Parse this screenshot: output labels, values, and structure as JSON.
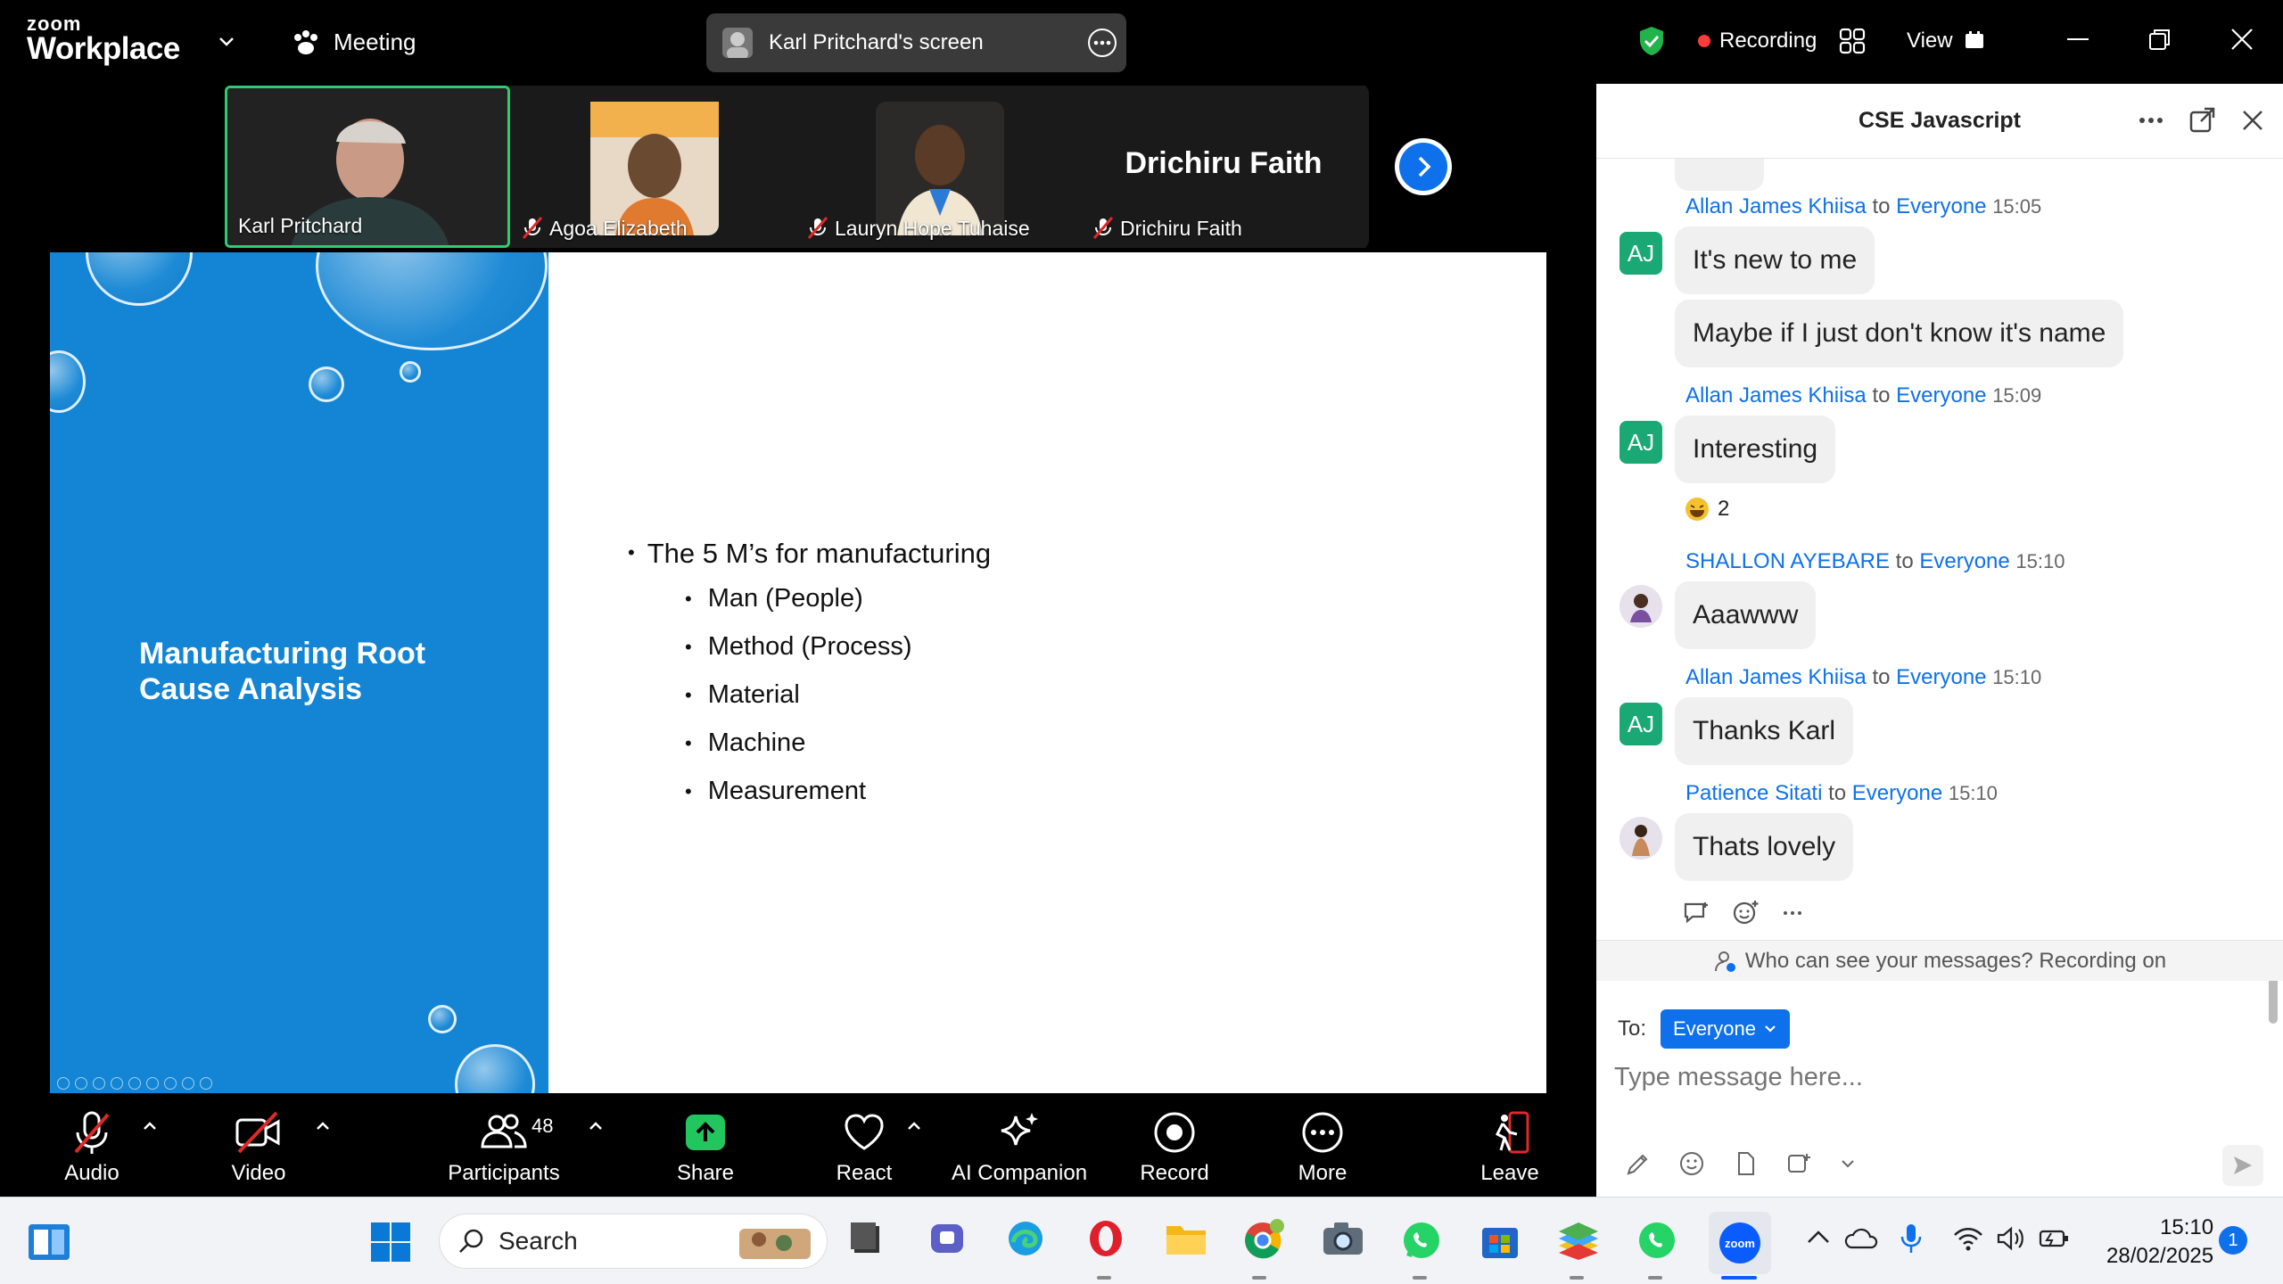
{
  "topbar": {
    "logo_small": "zoom",
    "logo_big": "Workplace",
    "meeting_label": "Meeting",
    "screen_share_label": "Karl Pritchard's screen",
    "recording_label": "Recording",
    "view_label": "View"
  },
  "participants_strip": [
    {
      "name": "Karl Pritchard",
      "muted": false,
      "active_speaker": true
    },
    {
      "name": "Agoa Elizabeth",
      "muted": true
    },
    {
      "name": "Lauryn Hope Tuhaise",
      "muted": true
    },
    {
      "name": "Drichiru Faith",
      "muted": true,
      "big_name": "Drichiru Faith"
    }
  ],
  "slide": {
    "title": "Manufacturing Root\nCause Analysis",
    "main_bullet": "The 5 M’s for manufacturing",
    "sub_bullets": [
      "Man (People)",
      "Method (Process)",
      "Material",
      "Machine",
      "Measurement"
    ]
  },
  "toolbar": {
    "audio": "Audio",
    "video": "Video",
    "participants": "Participants",
    "participants_count": "48",
    "share": "Share",
    "react": "React",
    "ai_companion": "AI Companion",
    "record": "Record",
    "more": "More",
    "leave": "Leave"
  },
  "chat": {
    "title": "CSE Javascript",
    "to_word": "to",
    "messages": [
      {
        "sender": "Allan James Khiisa",
        "recipient": "Everyone",
        "time": "15:05",
        "avatar": "AJ",
        "texts": [
          "It's new to me",
          "Maybe if I just don't know it's name"
        ]
      },
      {
        "sender": "Allan James Khiisa",
        "recipient": "Everyone",
        "time": "15:09",
        "avatar": "AJ",
        "texts": [
          "Interesting"
        ],
        "reaction_count": "2"
      },
      {
        "sender": "SHALLON AYEBARE",
        "recipient": "Everyone",
        "time": "15:10",
        "avatar": "",
        "texts": [
          "Aaawww"
        ]
      },
      {
        "sender": "Allan James Khiisa",
        "recipient": "Everyone",
        "time": "15:10",
        "avatar": "AJ",
        "texts": [
          "Thanks Karl"
        ]
      },
      {
        "sender": "Patience Sitati",
        "recipient": "Everyone",
        "time": "15:10",
        "avatar": "",
        "texts": [
          "Thats lovely"
        ]
      }
    ],
    "notice": "Who can see your messages? Recording on",
    "to_label": "To:",
    "to_value": "Everyone",
    "input_placeholder": "Type message here..."
  },
  "taskbar": {
    "search_label": "Search",
    "time": "15:10",
    "date": "28/02/2025",
    "notification_count": "1"
  },
  "colors": {
    "accent": "#0e71eb",
    "slide_blue": "#1385d4",
    "active_green": "#2ecc71",
    "avatar_green": "#1aa874",
    "leave_red": "#e02828"
  }
}
